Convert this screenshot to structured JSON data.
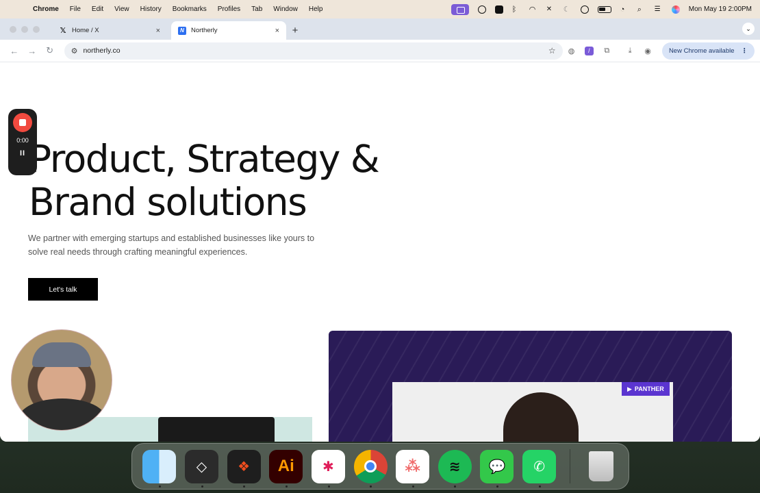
{
  "menubar": {
    "app": "Chrome",
    "items": [
      "File",
      "Edit",
      "View",
      "History",
      "Bookmarks",
      "Profiles",
      "Tab",
      "Window",
      "Help"
    ],
    "clock": "Mon May 19  2:00PM"
  },
  "tabs": [
    {
      "title": "Home / X",
      "favicon": "x-logo-icon",
      "close": "×"
    },
    {
      "title": "Northerly",
      "favicon": "northerly-logo-icon",
      "close": "×"
    }
  ],
  "toolbar": {
    "url": "northerly.co",
    "update_label": "New Chrome available",
    "more": "⋮"
  },
  "hero": {
    "title_line1": "Product, Strategy &",
    "title_line2": "Brand solutions",
    "subtitle": "We partner with emerging startups and established businesses like yours to solve real needs through crafting meaningful experiences.",
    "cta": "Let's talk"
  },
  "cards": {
    "badge": "PANTHER"
  },
  "recorder": {
    "time": "0:00",
    "pause": "II"
  },
  "dock": {
    "apps": [
      "Finder",
      "Linear",
      "Figma",
      "Adobe Illustrator",
      "Slack",
      "Google Chrome",
      "Asana",
      "Spotify",
      "Messages",
      "WhatsApp",
      "Trash"
    ],
    "illustrator_label": "Ai"
  }
}
